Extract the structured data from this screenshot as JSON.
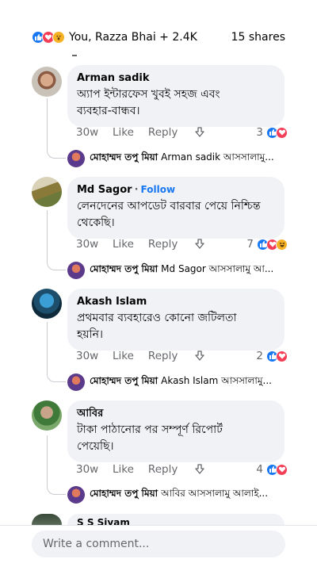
{
  "header": {
    "reactions": [
      "like-icon",
      "love-icon",
      "wow-icon"
    ],
    "reactors": "You, Razza Bhai + 2.4K",
    "shares": "15 shares"
  },
  "comments": [
    {
      "name": "Arman sadik",
      "follow": "",
      "text_lines": [
        "অ্যাপ ইন্টারফেস খুবই সহজ এবং",
        "ব্যবহার-বান্ধব।"
      ],
      "time": "30w",
      "like": "Like",
      "reply": "Reply",
      "count": "3",
      "reactions": [
        "like-icon",
        "love-icon"
      ],
      "reply_preview": {
        "name": "মোহাম্মদ তপু মিয়া",
        "text": "Arman sadik আসসালামু..."
      }
    },
    {
      "name": "Md Sagor",
      "follow": "Follow",
      "text_lines": [
        "লেনদেনের আপডেট বারবার পেয়ে নিশ্চিন্ত",
        "থেকেছি।"
      ],
      "time": "30w",
      "like": "Like",
      "reply": "Reply",
      "count": "7",
      "reactions": [
        "like-icon",
        "love-icon",
        "haha-icon"
      ],
      "reply_preview": {
        "name": "মোহাম্মদ তপু মিয়া",
        "text": "Md Sagor আসসালামু আ..."
      }
    },
    {
      "name": "Akash Islam",
      "follow": "",
      "text_lines": [
        "প্রথমবার ব্যবহারেও কোনো জটিলতা",
        "হয়নি।"
      ],
      "time": "30w",
      "like": "Like",
      "reply": "Reply",
      "count": "2",
      "reactions": [
        "like-icon",
        "love-icon"
      ],
      "reply_preview": {
        "name": "মোহাম্মদ তপু মিয়া",
        "text": "Akash Islam আসসালামু..."
      }
    },
    {
      "name": "আবির",
      "follow": "",
      "text_lines": [
        "টাকা পাঠানোর পর সম্পূর্ণ রিপোর্ট",
        "পেয়েছি।"
      ],
      "time": "30w",
      "like": "Like",
      "reply": "Reply",
      "count": "4",
      "reactions": [
        "like-icon",
        "love-icon"
      ],
      "reply_preview": {
        "name": "মোহাম্মদ তপু মিয়া",
        "text": "আবির আসসালামু আলাই..."
      }
    }
  ],
  "partial_comment": {
    "name": "S S Siyam"
  },
  "footer": {
    "placeholder": "Write a comment..."
  },
  "colors": {
    "accent": "#1877f2",
    "love": "#f33e58",
    "bubble": "#f0f2f5",
    "muted": "#65676b"
  }
}
